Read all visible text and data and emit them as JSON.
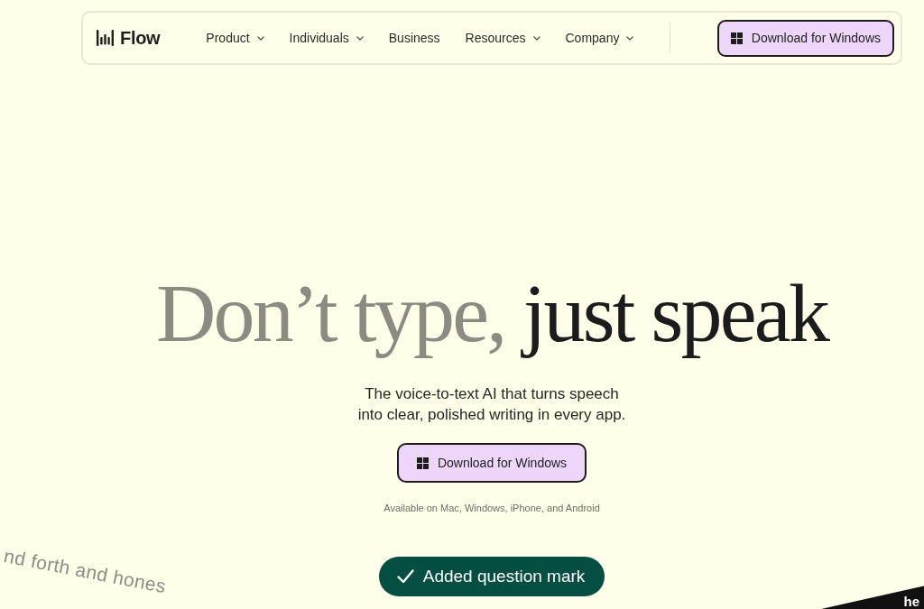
{
  "nav": {
    "logo": "Flow",
    "items": [
      {
        "label": "Product",
        "dropdown": true
      },
      {
        "label": "Individuals",
        "dropdown": true
      },
      {
        "label": "Business",
        "dropdown": false
      },
      {
        "label": "Resources",
        "dropdown": true
      },
      {
        "label": "Company",
        "dropdown": true
      }
    ],
    "cta": "Download for Windows"
  },
  "hero": {
    "headline": {
      "muted": "Don’t type,",
      "strong": "just speak"
    },
    "subtitle": "The voice-to-text AI that turns speech\ninto clear, polished writing in every app.",
    "cta": "Download for Windows",
    "availability": "Available on Mac, Windows, iPhone, and Android"
  },
  "toast": {
    "message": "Added question mark"
  },
  "decor": {
    "tilted_caption": "nd forth and hones",
    "corner_banner": "he"
  }
}
